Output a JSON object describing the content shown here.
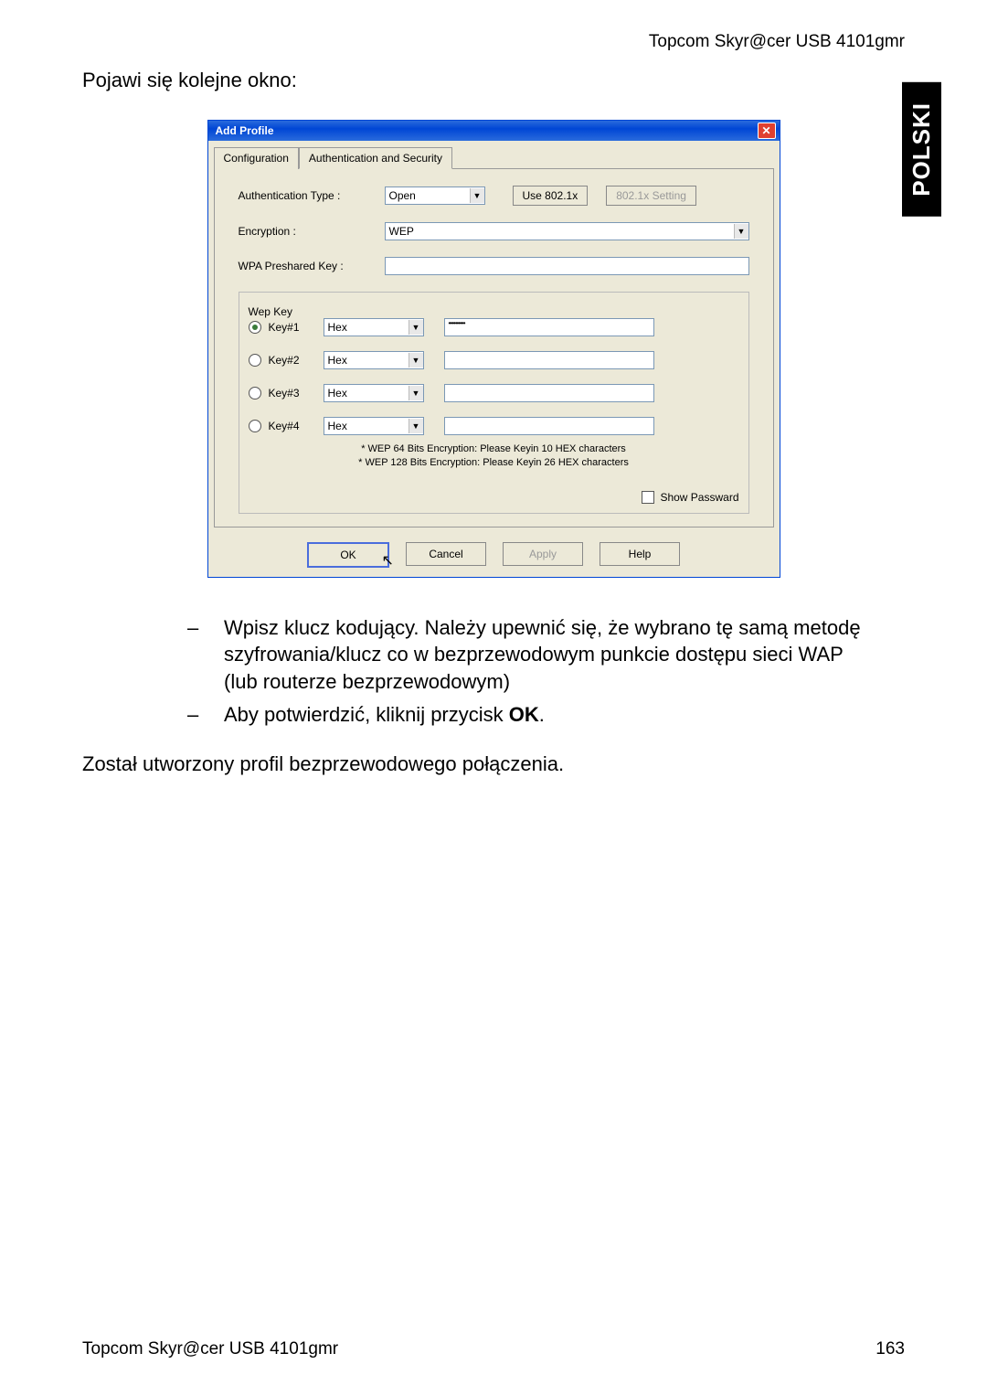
{
  "header": {
    "product": "Topcom Skyr@cer USB 4101gmr"
  },
  "langtab": "POLSKI",
  "intro": "Pojawi się kolejne okno:",
  "dialog": {
    "title": "Add Profile",
    "tabs": {
      "config": "Configuration",
      "auth": "Authentication and Security"
    },
    "labels": {
      "authtype": "Authentication Type :",
      "encryption": "Encryption :",
      "wpakey": "WPA Preshared Key :",
      "wepkey_legend": "Wep Key",
      "key1": "Key#1",
      "key2": "Key#2",
      "key3": "Key#3",
      "key4": "Key#4",
      "use8021x": "Use 802.1x",
      "setting8021x": "802.1x Setting",
      "showpw": "Show Passward"
    },
    "values": {
      "authtype": "Open",
      "encryption": "WEP",
      "wpakey": "",
      "hex": "Hex",
      "key1val": "••••••••••",
      "key2val": "",
      "key3val": "",
      "key4val": ""
    },
    "notes": {
      "l1": "* WEP 64 Bits Encryption:   Please Keyin 10 HEX characters",
      "l2": "* WEP 128 Bits Encryption:   Please Keyin 26 HEX characters"
    },
    "buttons": {
      "ok": "OK",
      "cancel": "Cancel",
      "apply": "Apply",
      "help": "Help"
    }
  },
  "bullets": {
    "b1": "Wpisz klucz kodujący. Należy upewnić się, że wybrano tę samą metodę szyfrowania/klucz co w bezprzewodowym punkcie dostępu sieci WAP (lub routerze bezprzewodowym)",
    "b2a": "Aby potwierdzić, kliknij przycisk ",
    "b2b": "OK",
    "b2c": "."
  },
  "conclusion": "Został utworzony profil bezprzewodowego połączenia.",
  "footer": {
    "left": "Topcom Skyr@cer USB 4101gmr",
    "right": "163"
  }
}
